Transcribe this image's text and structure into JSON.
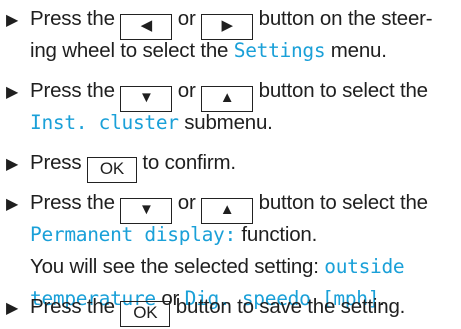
{
  "bullet_glyph": "▶",
  "keys": {
    "left": "◀",
    "right": "▶",
    "down": "▼",
    "up": "▲",
    "ok": "OK"
  },
  "steps": [
    {
      "press": "Press the",
      "or": "or",
      "rest": "button on the steer-",
      "line2a": "ing wheel to select the",
      "menu": "Settings",
      "line2b": "menu."
    },
    {
      "press": "Press the",
      "or": "or",
      "rest": "button to select the",
      "submenu": "Inst. cluster",
      "line2b": "submenu."
    },
    {
      "press": "Press",
      "rest": "to confirm."
    },
    {
      "press": "Press the",
      "or": "or",
      "rest": "button to select the",
      "function": "Permanent display:",
      "line2b": "function.",
      "line3": "You will see the selected setting:",
      "option1a": "outside",
      "option1b": "temperature",
      "or2": "or",
      "option2": "Dig. speedo [mph]",
      "period": "."
    },
    {
      "press": "Press the",
      "rest": "button to save the setting."
    }
  ]
}
